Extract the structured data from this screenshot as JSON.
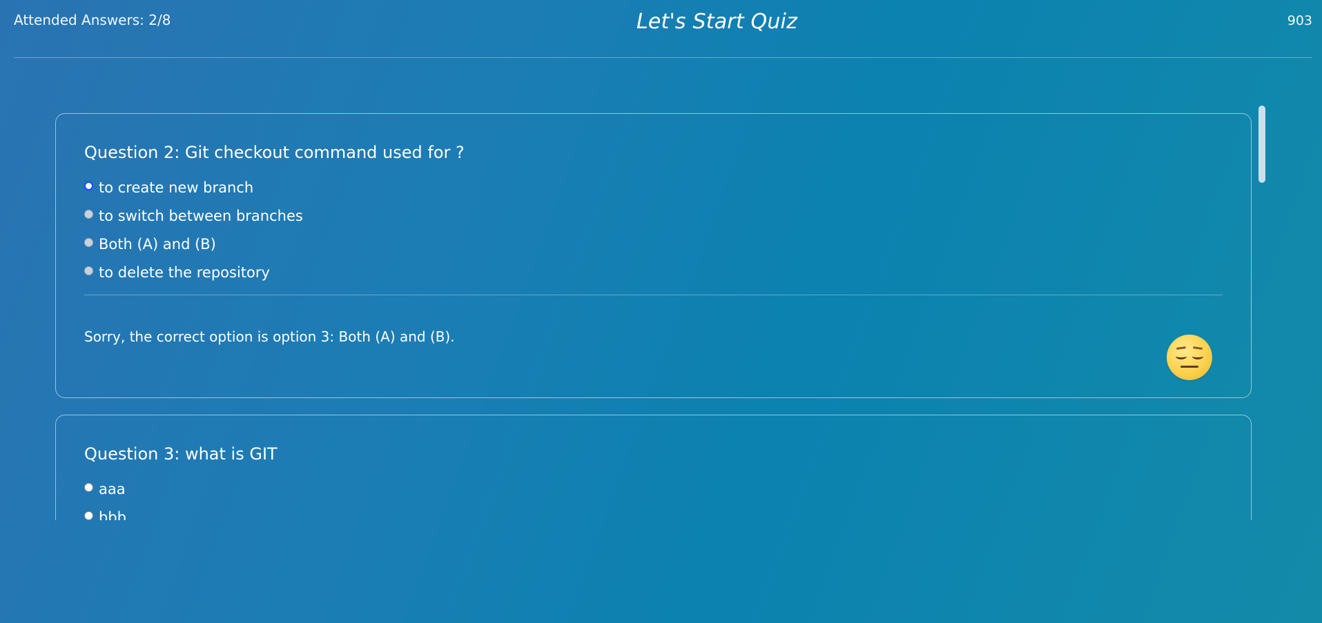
{
  "header": {
    "attended": "Attended Answers: 2/8",
    "title": "Let's Start Quiz",
    "counter": "903"
  },
  "questions": [
    {
      "title": "Question 2:  Git checkout command used for ?",
      "options": [
        "to create new branch",
        "to switch between branches",
        "Both (A) and (B)",
        "to delete the repository"
      ],
      "selected_index": 0,
      "feedback": "Sorry, the correct option is option 3: Both (A) and (B).",
      "feedback_icon": "sad-face-emoji"
    },
    {
      "title": "Question 3:  what is GIT",
      "options": [
        "aaa",
        "bbb"
      ]
    }
  ],
  "colors": {
    "background_start": "#2a73b2",
    "background_end": "#148aa9",
    "selected_radio": "#1a4bff",
    "text": "#ffffff"
  }
}
